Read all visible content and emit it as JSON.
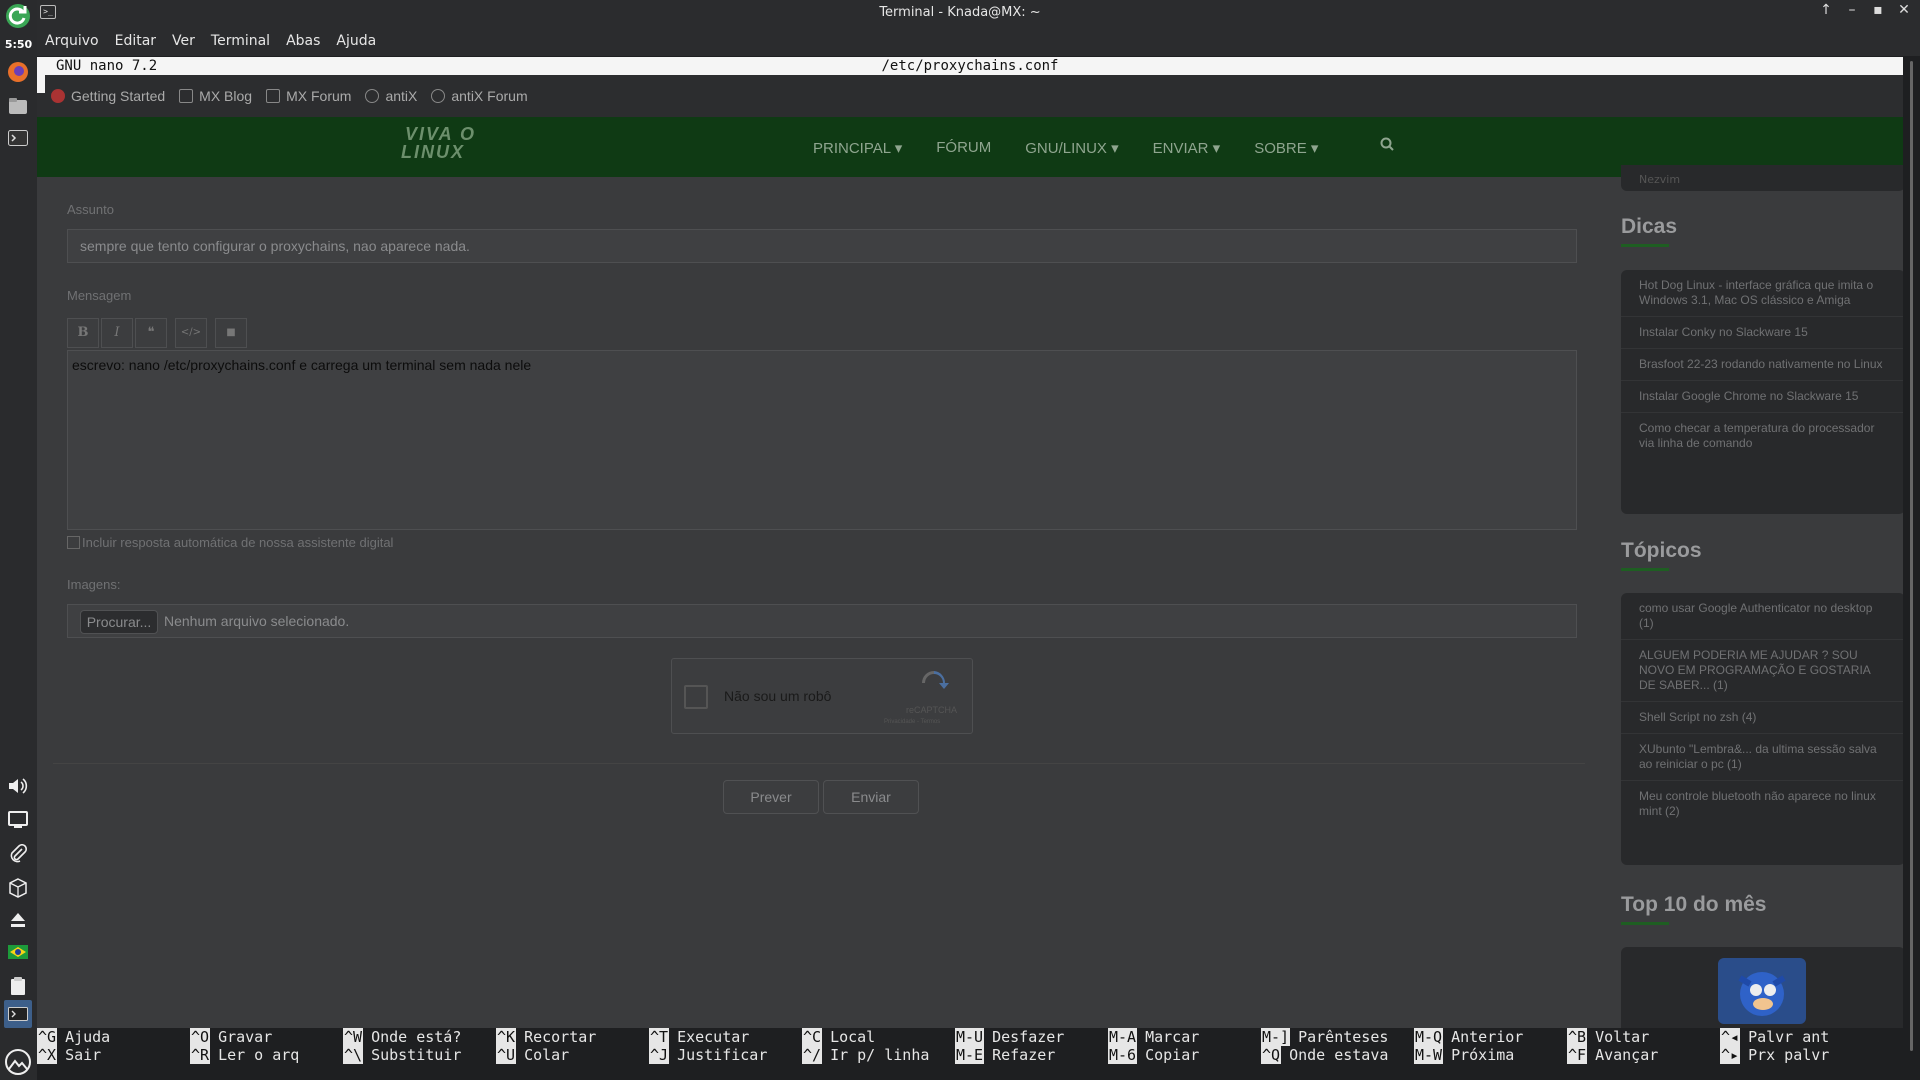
{
  "window": {
    "title": "Terminal - Knada@MX: ~",
    "controls": [
      "↑",
      "–",
      "▪",
      "✕"
    ]
  },
  "panel": {
    "clock": "5:50",
    "icons": [
      "refresh-icon",
      "firefox-icon",
      "file-manager-icon",
      "terminal-icon",
      "volume-icon",
      "display-icon",
      "paperclip-icon",
      "package-icon",
      "eject-icon",
      "flag-brazil-icon",
      "clipboard-icon",
      "terminal-active-icon",
      "mx-logo-icon"
    ]
  },
  "menubar": {
    "items": [
      "Arquivo",
      "Editar",
      "Ver",
      "Terminal",
      "Abas",
      "Ajuda"
    ]
  },
  "nano": {
    "version": "GNU nano 7.2",
    "filename": "/etc/proxychains.conf",
    "shortcuts": [
      [
        {
          "key": "^G",
          "label": "Ajuda"
        },
        {
          "key": "^X",
          "label": "Sair"
        }
      ],
      [
        {
          "key": "^O",
          "label": "Gravar"
        },
        {
          "key": "^R",
          "label": "Ler o arq"
        }
      ],
      [
        {
          "key": "^W",
          "label": "Onde está?"
        },
        {
          "key": "^\\",
          "label": "Substituir"
        }
      ],
      [
        {
          "key": "^K",
          "label": "Recortar"
        },
        {
          "key": "^U",
          "label": "Colar"
        }
      ],
      [
        {
          "key": "^T",
          "label": "Executar"
        },
        {
          "key": "^J",
          "label": "Justificar"
        }
      ],
      [
        {
          "key": "^C",
          "label": "Local"
        },
        {
          "key": "^/",
          "label": "Ir p/ linha"
        }
      ],
      [
        {
          "key": "M-U",
          "label": "Desfazer"
        },
        {
          "key": "M-E",
          "label": "Refazer"
        }
      ],
      [
        {
          "key": "M-A",
          "label": "Marcar"
        },
        {
          "key": "M-6",
          "label": "Copiar"
        }
      ],
      [
        {
          "key": "M-]",
          "label": "Parênteses"
        },
        {
          "key": "^Q",
          "label": "Onde estava"
        }
      ],
      [
        {
          "key": "M-Q",
          "label": "Anterior"
        },
        {
          "key": "M-W",
          "label": "Próxima"
        }
      ],
      [
        {
          "key": "^B",
          "label": "Voltar"
        },
        {
          "key": "^F",
          "label": "Avançar"
        }
      ],
      [
        {
          "key": "^◂",
          "label": "Palvr ant"
        },
        {
          "key": "^▸",
          "label": "Prx palvr"
        }
      ]
    ]
  },
  "browser": {
    "bookmarks": [
      "Getting Started",
      "MX Blog",
      "MX Forum",
      "antiX",
      "antiX Forum"
    ],
    "logo": [
      "VIVA O",
      "LINUX"
    ],
    "nav": [
      "PRINCIPAL",
      "FÓRUM",
      "GNU/LINUX",
      "ENVIAR",
      "SOBRE"
    ],
    "form": {
      "subject_label": "Assunto",
      "subject_value": "sempre que tento configurar o proxychains, nao aparece nada.",
      "message_label": "Mensagem",
      "toolbar": [
        "B",
        "I",
        "❝",
        "</>",
        "■"
      ],
      "message_value": "escrevo: nano /etc/proxychains.conf e carrega um terminal sem nada nele",
      "auto_reply_label": "Incluir resposta automática de nossa assistente digital",
      "images_label": "Imagens:",
      "browse_button": "Procurar...",
      "no_file": "Nenhum arquivo selecionado.",
      "captcha_label": "Não sou um robô",
      "captcha_brand": "reCAPTCHA",
      "captcha_links": "Privacidade - Termos",
      "preview_button": "Prever",
      "send_button": "Enviar"
    },
    "sidebar": {
      "top_fragment": "Nezvim",
      "dicas_title": "Dicas",
      "dicas": [
        "Hot Dog Linux - interface gráfica que imita o Windows 3.1, Mac OS clássico e Amiga",
        "Instalar Conky no Slackware 15",
        "Brasfoot 22-23 rodando nativamente no Linux",
        "Instalar Google Chrome no Slackware 15",
        "Como checar a temperatura do processador via linha de comando"
      ],
      "topicos_title": "Tópicos",
      "topicos": [
        "como usar Google Authenticator no desktop (1)",
        "ALGUEM PODERIA ME AJUDAR ? SOU NOVO EM PROGRAMAÇÃO E GOSTARIA DE SABER... (1)",
        "Shell Script no zsh (4)",
        "XUbunto \"Lembra&... da ultima sessão salva ao reiniciar o pc (1)",
        "Meu controle bluetooth não aparece no linux mint (2)"
      ],
      "top10_title": "Top 10 do mês"
    }
  }
}
